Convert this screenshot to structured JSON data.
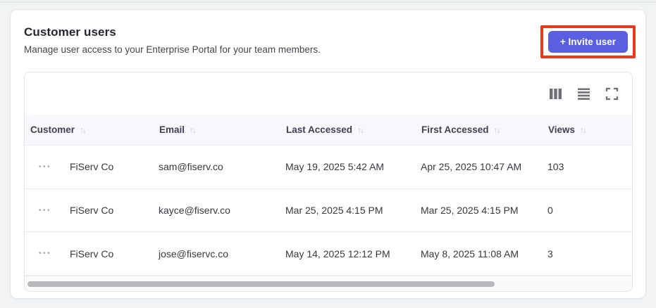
{
  "page": {
    "title": "Customer users",
    "subtitle": "Manage user access to your Enterprise Portal for your team members."
  },
  "header": {
    "invite_button_label": "+ Invite user",
    "annotation": "red highlight box around invite button"
  },
  "colors": {
    "accent": "#5a5fe0",
    "annotation_red": "#e8391d",
    "header_row_bg": "#f8f8fc",
    "card_bg": "#ffffff",
    "page_bg": "#f1f3f5",
    "icon_gray": "#6f6f76"
  },
  "toolbar": {
    "icons": [
      {
        "name": "columns-icon"
      },
      {
        "name": "density-icon"
      },
      {
        "name": "fullscreen-icon"
      }
    ]
  },
  "table": {
    "sort_glyph": "↑↓",
    "dots_glyph": "•••",
    "columns": [
      {
        "label": "Customer",
        "sortable": true
      },
      {
        "label": "Email",
        "sortable": true
      },
      {
        "label": "Last Accessed",
        "sortable": true
      },
      {
        "label": "First Accessed",
        "sortable": true
      },
      {
        "label": "Views",
        "sortable": true
      }
    ],
    "rows": [
      {
        "customer": "FiServ Co",
        "email": "sam@fiserv.co",
        "last_accessed": "May 19, 2025 5:42 AM",
        "first_accessed": "Apr 25, 2025 10:47 AM",
        "views": "103"
      },
      {
        "customer": "FiServ Co",
        "email": "kayce@fiserv.co",
        "last_accessed": "Mar 25, 2025 4:15 PM",
        "first_accessed": "Mar 25, 2025 4:15 PM",
        "views": "0"
      },
      {
        "customer": "FiServ Co",
        "email": "jose@fiservc.co",
        "last_accessed": "May 14, 2025 12:12 PM",
        "first_accessed": "May 8, 2025 11:08 AM",
        "views": "3"
      }
    ]
  }
}
